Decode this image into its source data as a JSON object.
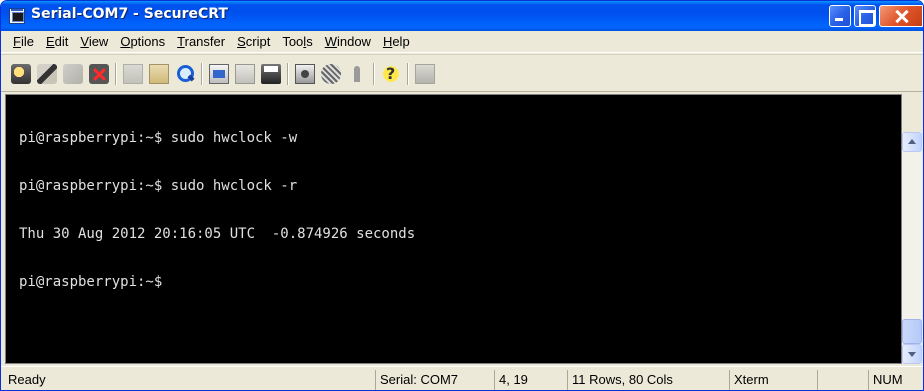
{
  "window": {
    "title": "Serial-COM7 - SecureCRT"
  },
  "menu": [
    {
      "label": "File",
      "accel": "F",
      "rest": "ile"
    },
    {
      "label": "Edit",
      "accel": "E",
      "rest": "dit"
    },
    {
      "label": "View",
      "accel": "V",
      "rest": "iew"
    },
    {
      "label": "Options",
      "accel": "O",
      "rest": "ptions"
    },
    {
      "label": "Transfer",
      "accel": "T",
      "rest": "ransfer"
    },
    {
      "label": "Script",
      "accel": "S",
      "rest": "cript"
    },
    {
      "label": "Tools",
      "pre": "Too",
      "accel": "l",
      "rest": "s"
    },
    {
      "label": "Window",
      "accel": "W",
      "rest": "indow"
    },
    {
      "label": "Help",
      "accel": "H",
      "rest": "elp"
    }
  ],
  "terminal": {
    "lines": [
      "pi@raspberrypi:~$ sudo hwclock -w",
      "pi@raspberrypi:~$ sudo hwclock -r",
      "Thu 30 Aug 2012 20:16:05 UTC  -0.874926 seconds",
      "pi@raspberrypi:~$"
    ]
  },
  "status": {
    "ready": "Ready",
    "connection": "Serial: COM7",
    "cursor": "4, 19",
    "size": "11 Rows, 80 Cols",
    "emulation": "Xterm",
    "blank": "",
    "num": "NUM"
  }
}
